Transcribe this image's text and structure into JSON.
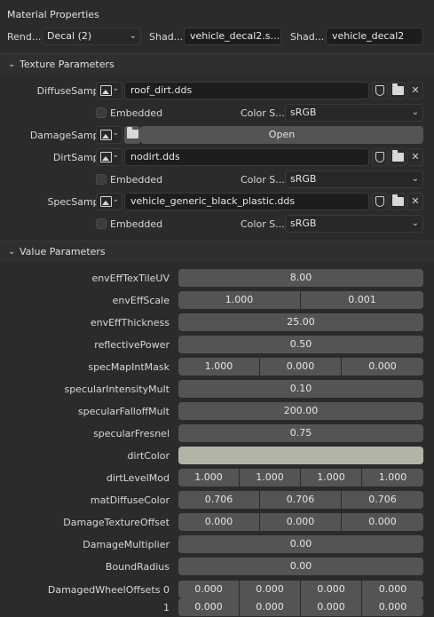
{
  "panel": {
    "title": "Material Properties"
  },
  "top": {
    "render_label": "Rend...",
    "render_value": "Decal (2)",
    "shader1_label": "Shad...",
    "shader1_value": "vehicle_decal2.s...",
    "shader2_label": "Shad...",
    "shader2_value": "vehicle_decal2"
  },
  "texture_section": {
    "title": "Texture Parameters"
  },
  "samplers": {
    "diffuse": {
      "label": "DiffuseSampler",
      "file": "roof_dirt.dds",
      "embedded": "Embedded",
      "color_label": "Color S...",
      "color_value": "sRGB"
    },
    "damage": {
      "label": "DamageSampler",
      "open": "Open"
    },
    "dirt": {
      "label": "DirtSampler",
      "file": "nodirt.dds",
      "embedded": "Embedded",
      "color_label": "Color S...",
      "color_value": "sRGB"
    },
    "spec": {
      "label": "SpecSampler",
      "file": "vehicle_generic_black_plastic.dds",
      "embedded": "Embedded",
      "color_label": "Color S...",
      "color_value": "sRGB"
    }
  },
  "value_section": {
    "title": "Value Parameters"
  },
  "params": {
    "envEffTexTileUV": {
      "label": "envEffTexTileUV",
      "v": [
        "8.00"
      ]
    },
    "envEffScale": {
      "label": "envEffScale",
      "v": [
        "1.000",
        "0.001"
      ]
    },
    "envEffThickness": {
      "label": "envEffThickness",
      "v": [
        "25.00"
      ]
    },
    "reflectivePower": {
      "label": "reflectivePower",
      "v": [
        "0.50"
      ]
    },
    "specMapIntMask": {
      "label": "specMapIntMask",
      "v": [
        "1.000",
        "0.000",
        "0.000"
      ]
    },
    "specularIntensityMult": {
      "label": "specularIntensityMult",
      "v": [
        "0.10"
      ]
    },
    "specularFalloffMult": {
      "label": "specularFalloffMult",
      "v": [
        "200.00"
      ]
    },
    "specularFresnel": {
      "label": "specularFresnel",
      "v": [
        "0.75"
      ]
    },
    "dirtColor": {
      "label": "dirtColor",
      "color": "#b4b4a6"
    },
    "dirtLevelMod": {
      "label": "dirtLevelMod",
      "v": [
        "1.000",
        "1.000",
        "1.000",
        "1.000"
      ]
    },
    "matDiffuseColor": {
      "label": "matDiffuseColor",
      "v": [
        "0.706",
        "0.706",
        "0.706"
      ]
    },
    "DamageTextureOffset": {
      "label": "DamageTextureOffset",
      "v": [
        "0.000",
        "0.000",
        "0.000"
      ]
    },
    "DamageMultiplier": {
      "label": "DamageMultiplier",
      "v": [
        "0.00"
      ]
    },
    "BoundRadius": {
      "label": "BoundRadius",
      "v": [
        "0.00"
      ]
    },
    "DamagedWheelOffsets0": {
      "label": "DamagedWheelOffsets 0",
      "v": [
        "0.000",
        "0.000",
        "0.000",
        "0.000"
      ]
    },
    "DamagedWheelOffsets1": {
      "label": "1",
      "v": [
        "0.000",
        "0.000",
        "0.000",
        "0.000"
      ]
    }
  }
}
